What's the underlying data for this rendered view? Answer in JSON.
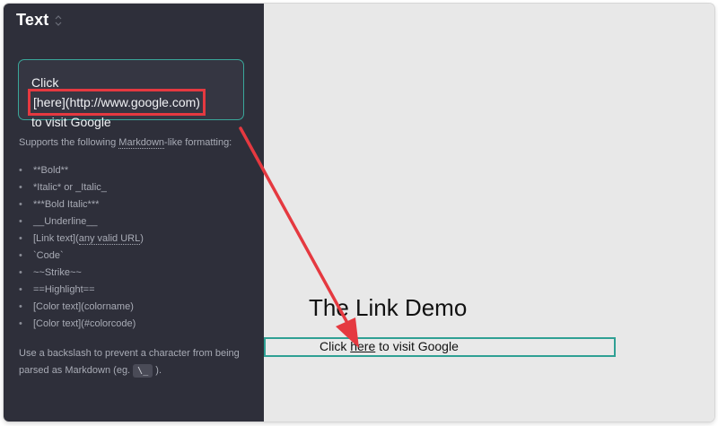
{
  "panel": {
    "title": "Text",
    "sort_icon": "sort-arrows-icon",
    "text_value": {
      "prefix": "Click ",
      "link_markup": "[here](http://www.google.com)",
      "suffix": "to visit Google"
    },
    "help": {
      "intro_pre": "Supports the following ",
      "intro_term": "Markdown",
      "intro_post": "-like formatting:",
      "items": [
        "**Bold**",
        "*Italic* or _Italic_",
        "***Bold Italic***",
        "__Underline__",
        "[Link text](any valid URL)",
        "`Code`",
        "~~Strike~~",
        "==Highlight==",
        "[Color text](colorname)",
        "[Color text](#colorcode)"
      ],
      "backslash_pre": "Use a backslash to prevent a character from being parsed as Markdown (eg. ",
      "backslash_code": "\\_",
      "backslash_post": ")."
    }
  },
  "canvas": {
    "title": "The Link Demo",
    "line": {
      "prefix": "Click ",
      "link_text": "here",
      "suffix": " to visit Google"
    }
  },
  "colors": {
    "panel_bg": "#2e2f3a",
    "accent_teal": "#3aa79a",
    "annotation_red": "#e53940",
    "canvas_bg": "#e8e8e8"
  }
}
